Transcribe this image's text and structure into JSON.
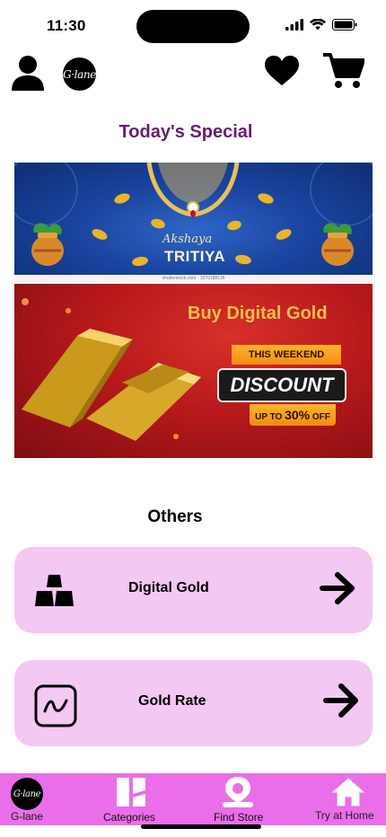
{
  "status_bar": {
    "time": "11:30"
  },
  "header": {
    "logo_text": "G·lane"
  },
  "main": {
    "special_title": "Today's Special",
    "banner_akshaya": {
      "line1": "Akshaya",
      "line2": "TRITIYA",
      "credit": "shutterstock.com · 1970188136"
    },
    "banner_digital": {
      "headline": "Buy Digital Gold",
      "tag": "THIS WEEKEND",
      "discount": "DISCOUNT",
      "upto_prefix": "UP TO ",
      "upto_value": "30%",
      "upto_suffix": " OFF"
    },
    "others_title": "Others",
    "cards": [
      {
        "label": "Digital Gold",
        "icon": "gold-bars-icon"
      },
      {
        "label": "Gold Rate",
        "icon": "chart-line-icon"
      }
    ]
  },
  "bottom_nav": {
    "items": [
      {
        "label": "G-lane",
        "icon": "logo-icon"
      },
      {
        "label": "Categories",
        "icon": "categories-icon"
      },
      {
        "label": "Find Store",
        "icon": "store-locator-icon"
      },
      {
        "label": "Try at Home",
        "icon": "home-icon"
      }
    ]
  },
  "colors": {
    "title_purple": "#6a1b6f",
    "card_pink": "#f3c8f2",
    "nav_magenta": "#ea6eea"
  }
}
